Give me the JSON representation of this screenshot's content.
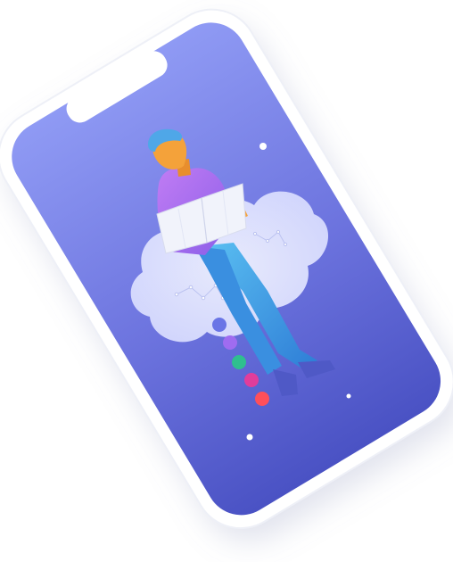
{
  "illustration": {
    "subject": "phone-mockup-person-reading-map",
    "colors": {
      "screen_top": "#8f9af4",
      "screen_bottom": "#4a52c4",
      "phone_frame": "#ffffff",
      "shirt": "#b36cf0",
      "pants": "#3aa3e3",
      "skin": "#f4a23a",
      "hair": "#4fa7e8",
      "cloud": "#e8ebff",
      "dot_1": "#6a75e6",
      "dot_2": "#9f6cf0",
      "dot_3": "#2fbf8f",
      "dot_4": "#e13d9b",
      "dot_5": "#ff4f5a"
    }
  }
}
